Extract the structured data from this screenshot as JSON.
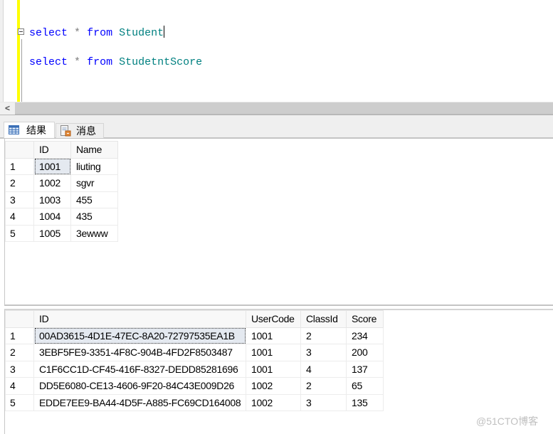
{
  "editor": {
    "lines": [
      {
        "keyword1": "select",
        "operator": "*",
        "keyword2": "from",
        "table": "Student"
      },
      {
        "keyword1": "select",
        "operator": "*",
        "keyword2": "from",
        "table": "StudetntScore"
      }
    ]
  },
  "scrollbar": {
    "left_arrow": "<"
  },
  "tabs": [
    {
      "label": "结果",
      "icon": "grid-icon",
      "active": true
    },
    {
      "label": "消息",
      "icon": "messages-icon",
      "active": false
    }
  ],
  "result1": {
    "columns": [
      "ID",
      "Name"
    ],
    "rows": [
      [
        "1",
        "1001",
        "liuting"
      ],
      [
        "2",
        "1002",
        "sgvr"
      ],
      [
        "3",
        "1003",
        "455"
      ],
      [
        "4",
        "1004",
        "435"
      ],
      [
        "5",
        "1005",
        "3ewww"
      ]
    ]
  },
  "result2": {
    "columns": [
      "ID",
      "UserCode",
      "ClassId",
      "Score"
    ],
    "rows": [
      [
        "1",
        "00AD3615-4D1E-47EC-8A20-72797535EA1B",
        "1001",
        "2",
        "234"
      ],
      [
        "2",
        "3EBF5FE9-3351-4F8C-904B-4FD2F8503487",
        "1001",
        "3",
        "200"
      ],
      [
        "3",
        "C1F6CC1D-CF45-416F-8327-DEDD85281696",
        "1001",
        "4",
        "137"
      ],
      [
        "4",
        "DD5E6080-CE13-4606-9F20-84C43E009D26",
        "1002",
        "2",
        "65"
      ],
      [
        "5",
        "EDDE7EE9-BA44-4D5F-A885-FC69CD164008",
        "1002",
        "3",
        "135"
      ]
    ]
  },
  "watermark": "@51CTO博客"
}
